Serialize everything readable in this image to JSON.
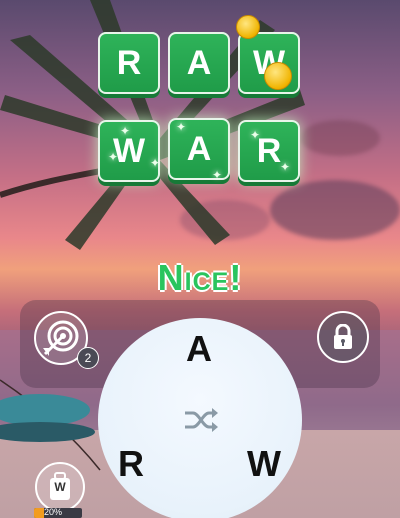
{
  "answer_grid": {
    "row1": [
      "R",
      "A",
      "W"
    ],
    "row2": [
      "W",
      "A",
      "R"
    ]
  },
  "feedback": "Nice!",
  "hint_target": {
    "icon": "target-arrow-icon",
    "count": "2"
  },
  "lock": {
    "icon": "lock-icon"
  },
  "letter_wheel": {
    "letters": [
      "A",
      "R",
      "W"
    ],
    "shuffle_icon": "shuffle-icon"
  },
  "booster": {
    "icon": "booster-icon",
    "letter": "W",
    "progress_label": "20%",
    "progress_fraction": 0.2
  },
  "colors": {
    "tile_green": "#22a34f",
    "nice_green": "#2ac45e",
    "coin_gold": "#f0b400",
    "booster_orange": "#f29c1f"
  }
}
